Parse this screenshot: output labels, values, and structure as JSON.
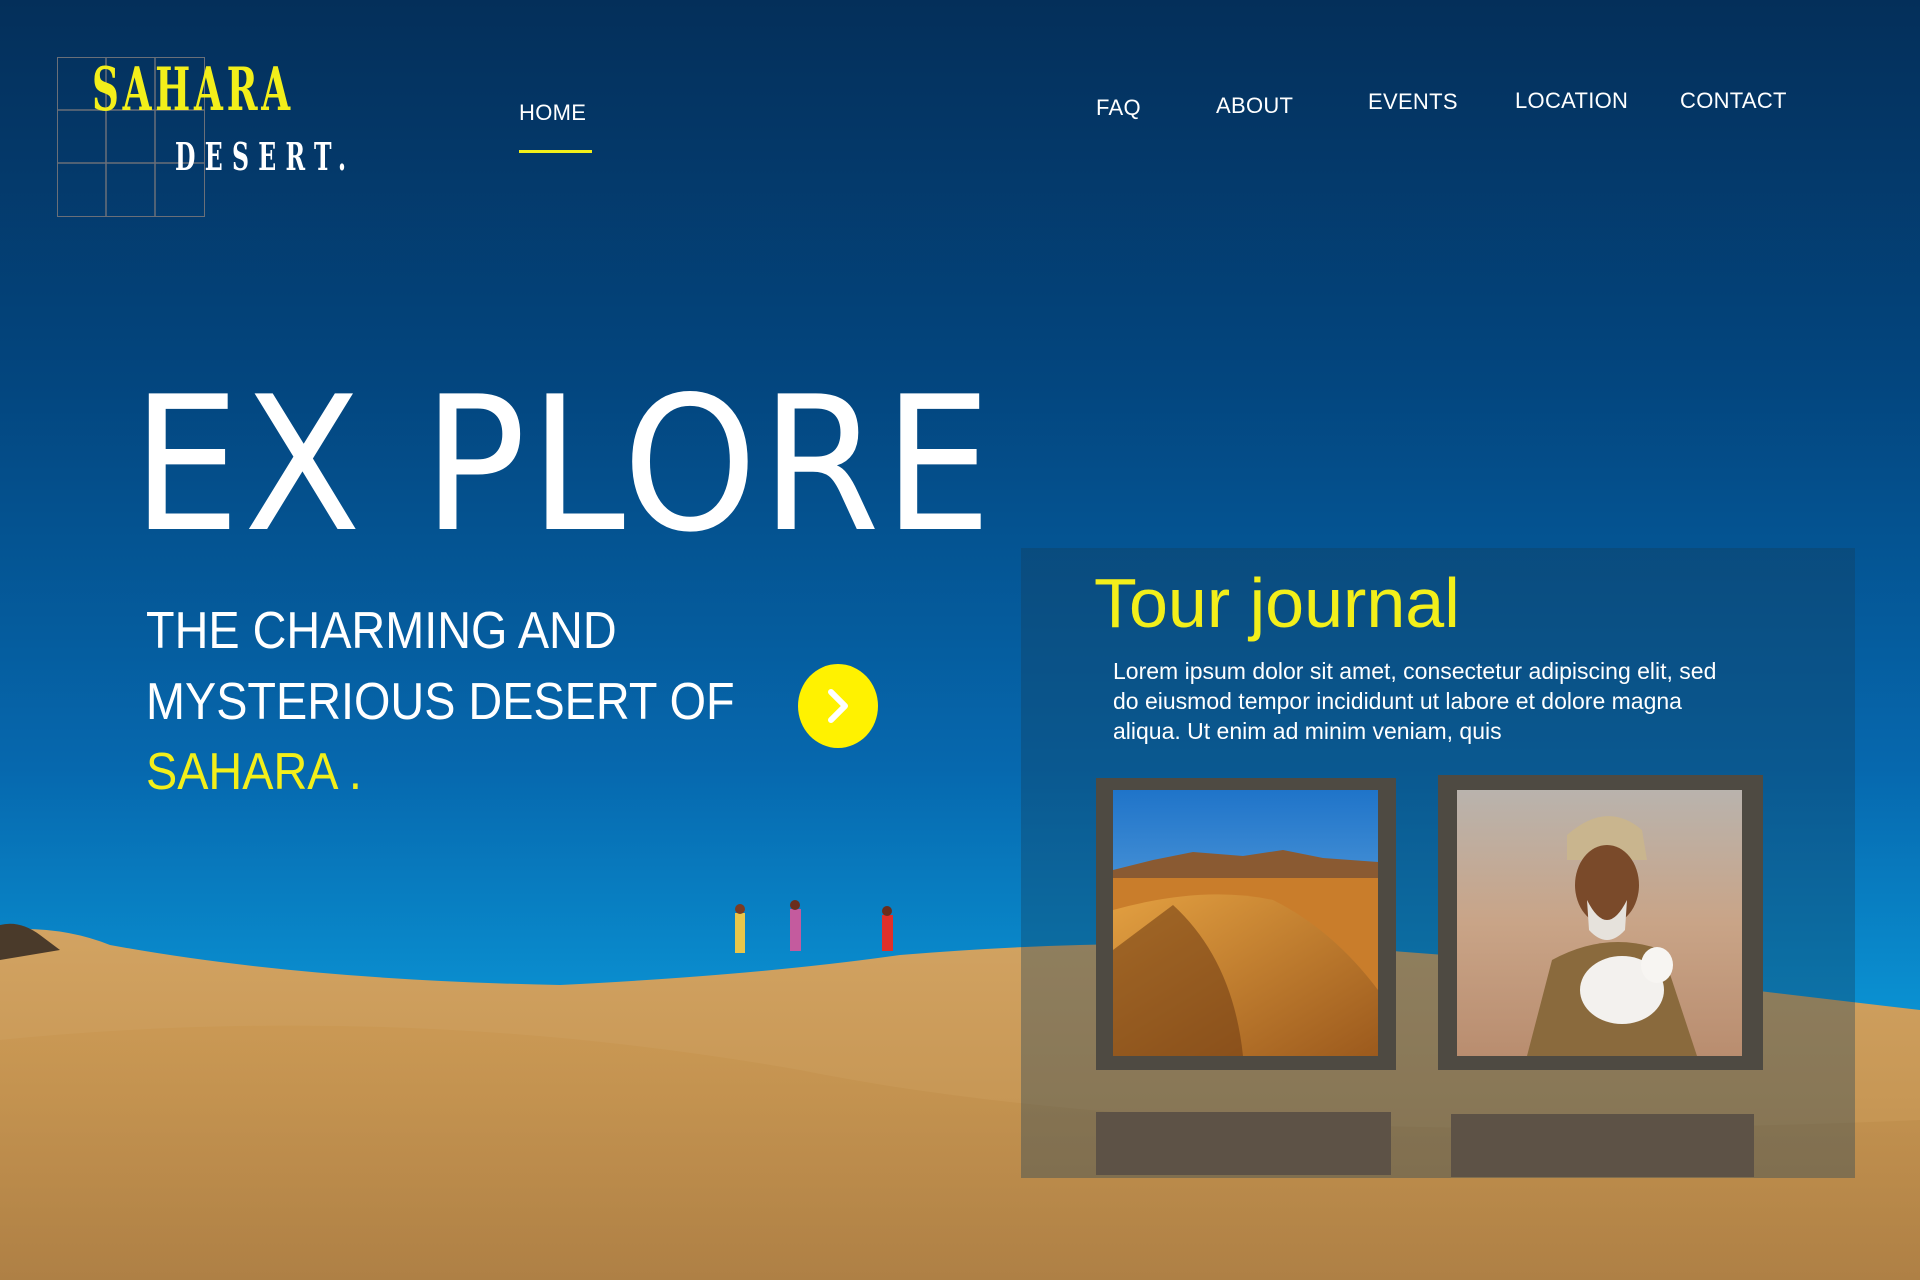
{
  "logo": {
    "line1": "SAHARA",
    "line2": "DESERT."
  },
  "nav": {
    "home": "HOME",
    "faq": "FAQ",
    "about": "ABOUT",
    "events": "EVENTS",
    "location": "LOCATION",
    "contact": "CONTACT",
    "active": "HOME"
  },
  "hero": {
    "title": "EX PLORE",
    "line1": "THE CHARMING AND",
    "line2": "MYSTERIOUS DESERT OF",
    "line3": "SAHARA ."
  },
  "buttons": {
    "next_icon": "chevron-right-icon"
  },
  "journal": {
    "title": "Tour journal",
    "text": "Lorem ipsum dolor sit amet, consectetur adipiscing elit, sed do eiusmod tempor incididunt ut labore et dolore magna aliqua. Ut enim ad minim veniam, quis"
  },
  "colors": {
    "accent": "#f3ef1a",
    "sky": "#0668ae",
    "sand": "#c9995a"
  }
}
